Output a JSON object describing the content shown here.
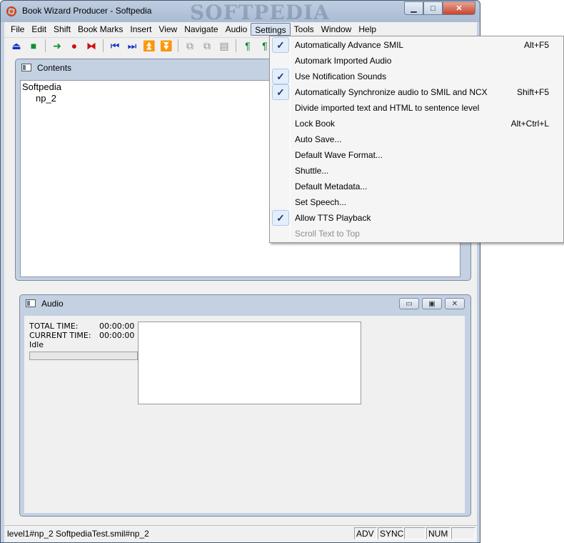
{
  "window": {
    "title": "Book Wizard Producer - Softpedia",
    "watermark": "SOFTPEDIA",
    "minimize": "▁",
    "maximize": "□",
    "close": "✕"
  },
  "menubar": [
    "File",
    "Edit",
    "Shift",
    "Book Marks",
    "Insert",
    "View",
    "Navigate",
    "Audio",
    "Settings",
    "Tools",
    "Window",
    "Help"
  ],
  "toolbar": [
    {
      "icon": "eject-icon",
      "glyph": "⏏",
      "color": "#1030c0"
    },
    {
      "icon": "stop-icon",
      "glyph": "■",
      "color": "#109030"
    },
    {
      "icon": "play-arrow-icon",
      "glyph": "➜",
      "color": "#109030"
    },
    {
      "icon": "record-icon",
      "glyph": "●",
      "color": "#d01010"
    },
    {
      "icon": "split-icon",
      "glyph": "⧓",
      "color": "#d01010"
    },
    {
      "icon": "skip-start-icon",
      "glyph": "⏮",
      "color": "#1030c0"
    },
    {
      "icon": "skip-end-icon",
      "glyph": "⏭",
      "color": "#1030c0"
    },
    {
      "icon": "move-up-icon",
      "glyph": "⏫",
      "color": "#1030c0"
    },
    {
      "icon": "move-down-icon",
      "glyph": "⏬",
      "color": "#1030c0"
    },
    {
      "icon": "copy-icon",
      "glyph": "⧉",
      "color": "#909090"
    },
    {
      "icon": "paste-icon",
      "glyph": "⧉",
      "color": "#909090"
    },
    {
      "icon": "document-icon",
      "glyph": "▤",
      "color": "#909090"
    },
    {
      "icon": "para-left-icon",
      "glyph": "¶",
      "color": "#108030"
    },
    {
      "icon": "para-right-icon",
      "glyph": "¶",
      "color": "#108030"
    }
  ],
  "contents": {
    "title": "Contents",
    "tree": [
      "Softpedia",
      "np_2"
    ]
  },
  "audio": {
    "title": "Audio",
    "total_label": "TOTAL TIME:",
    "total_value": "00:00:00",
    "current_label": "CURRENT TIME:",
    "current_value": "00:00:00",
    "state": "Idle",
    "minimize": "▭",
    "restore": "▣",
    "close": "✕"
  },
  "status": {
    "text": "level1#np_2 SoftpediaTest.smil#np_2",
    "adv": "ADV",
    "sync": "SYNC",
    "blank": "",
    "num": "NUM"
  },
  "settings_menu": [
    {
      "label": "Automatically Advance SMIL",
      "shortcut": "Alt+F5",
      "checked": true,
      "disabled": false
    },
    {
      "label": "Automark Imported Audio",
      "shortcut": "",
      "checked": false,
      "disabled": false
    },
    {
      "label": "Use Notification Sounds",
      "shortcut": "",
      "checked": true,
      "disabled": false
    },
    {
      "label": "Automatically Synchronize audio to SMIL and NCX",
      "shortcut": "Shift+F5",
      "checked": true,
      "disabled": false
    },
    {
      "label": "Divide imported text and HTML to sentence level",
      "shortcut": "",
      "checked": false,
      "disabled": false
    },
    {
      "label": "Lock Book",
      "shortcut": "Alt+Ctrl+L",
      "checked": false,
      "disabled": false
    },
    {
      "label": "Auto Save...",
      "shortcut": "",
      "checked": false,
      "disabled": false
    },
    {
      "label": "Default Wave Format...",
      "shortcut": "",
      "checked": false,
      "disabled": false
    },
    {
      "label": "Shuttle...",
      "shortcut": "",
      "checked": false,
      "disabled": false
    },
    {
      "label": "Default Metadata...",
      "shortcut": "",
      "checked": false,
      "disabled": false
    },
    {
      "label": "Set Speech...",
      "shortcut": "",
      "checked": false,
      "disabled": false
    },
    {
      "label": "Allow TTS Playback",
      "shortcut": "",
      "checked": true,
      "disabled": false
    },
    {
      "label": "Scroll Text to Top",
      "shortcut": "",
      "checked": false,
      "disabled": true
    }
  ],
  "check_glyph": "✓"
}
